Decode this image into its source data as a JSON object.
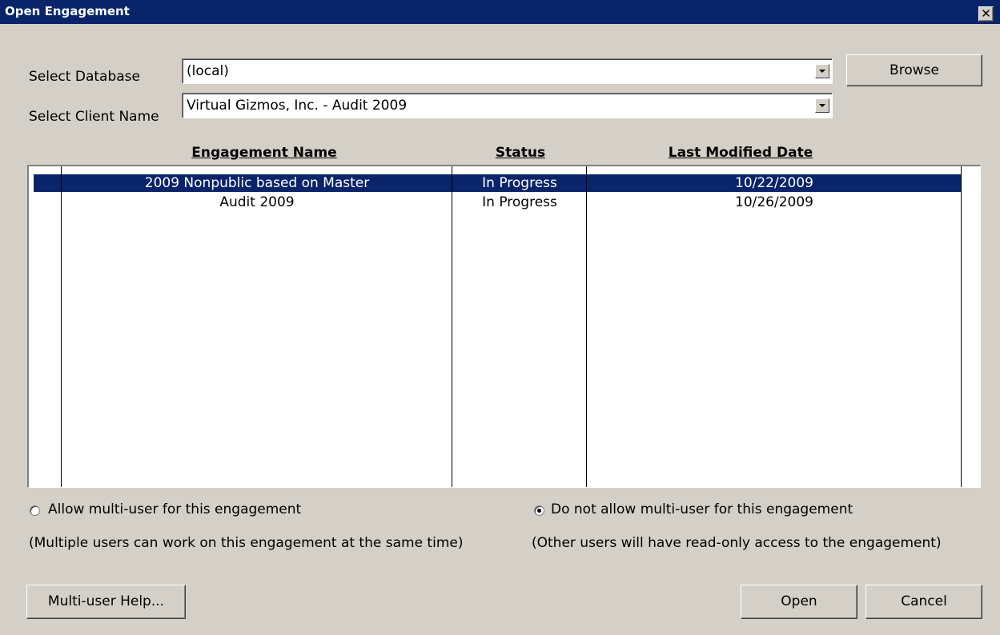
{
  "window": {
    "title": "Open Engagement",
    "close_glyph": "✕"
  },
  "database": {
    "label": "Select Database",
    "value": "(local)",
    "browse_label": "Browse"
  },
  "client": {
    "label": "Select Client Name",
    "value": "Virtual Gizmos, Inc. - Audit 2009"
  },
  "table": {
    "columns": [
      "Engagement Name",
      "Status",
      "Last Modified Date"
    ],
    "rows": [
      {
        "name": "2009 Nonpublic based on Master",
        "status": "In Progress",
        "modified": "10/22/2009",
        "selected": true
      },
      {
        "name": "Audit 2009",
        "status": "In Progress",
        "modified": "10/26/2009",
        "selected": false
      }
    ]
  },
  "multiuser": {
    "allow_label": "Allow multi-user for this engagement",
    "allow_desc": "(Multiple users can work on this engagement at the same time)",
    "allow_checked": false,
    "deny_label": "Do not allow multi-user for this engagement",
    "deny_desc": "(Other users will have read-only access to the engagement)",
    "deny_checked": true
  },
  "buttons": {
    "help": "Multi-user Help...",
    "open": "Open",
    "cancel": "Cancel"
  },
  "colors": {
    "titlebar": "#0a246a",
    "selection": "#0a246a",
    "face": "#d4d0c8"
  }
}
